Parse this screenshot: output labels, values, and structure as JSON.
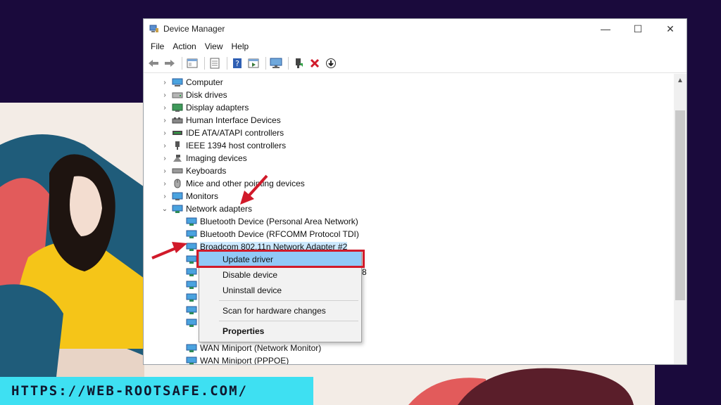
{
  "window": {
    "title": "Device Manager",
    "minimize_glyph": "—",
    "maximize_glyph": "☐",
    "close_glyph": "✕"
  },
  "menu": [
    "File",
    "Action",
    "View",
    "Help"
  ],
  "toolbar_icons": [
    "back-icon",
    "forward-icon",
    "properties-icon",
    "details-icon",
    "help-icon",
    "view-icon",
    "monitor-icon",
    "add-driver-icon",
    "uninstall-icon",
    "update-icon"
  ],
  "tree": {
    "categories": [
      {
        "label": "Computer",
        "icon": "computer-icon",
        "expanded": false
      },
      {
        "label": "Disk drives",
        "icon": "disk-icon",
        "expanded": false
      },
      {
        "label": "Display adapters",
        "icon": "display-icon",
        "expanded": false
      },
      {
        "label": "Human Interface Devices",
        "icon": "hid-icon",
        "expanded": false
      },
      {
        "label": "IDE ATA/ATAPI controllers",
        "icon": "ide-icon",
        "expanded": false
      },
      {
        "label": "IEEE 1394 host controllers",
        "icon": "firewire-icon",
        "expanded": false
      },
      {
        "label": "Imaging devices",
        "icon": "camera-icon",
        "expanded": false
      },
      {
        "label": "Keyboards",
        "icon": "keyboard-icon",
        "expanded": false
      },
      {
        "label": "Mice and other pointing devices",
        "icon": "mouse-icon",
        "expanded": false
      },
      {
        "label": "Monitors",
        "icon": "monitor-icon",
        "expanded": false
      },
      {
        "label": "Network adapters",
        "icon": "network-icon",
        "expanded": true
      }
    ],
    "network_children": [
      "Bluetooth Device (Personal Area Network)",
      "Bluetooth Device (RFCOMM Protocol TDI)",
      "Broadcom 802.11n Network Adapter #2",
      "",
      "8",
      "",
      "",
      "",
      "",
      "WAN Miniport (Network Monitor)",
      "WAN Miniport (PPPOE)"
    ]
  },
  "context_menu": {
    "items": [
      "Update driver",
      "Disable device",
      "Uninstall device",
      "Scan for hardware changes",
      "Properties"
    ]
  },
  "footer": {
    "url": "HTTPS://WEB-ROOTSAFE.COM/"
  },
  "colors": {
    "background_dark": "#1a0a3c",
    "accent_cyan": "#3ee0f2",
    "highlight_red": "#d11a2a",
    "selection_blue": "#91c9f7"
  }
}
